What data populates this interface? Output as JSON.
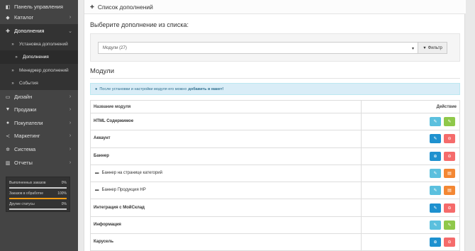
{
  "sidebar": {
    "items": [
      {
        "label": "Панель управления",
        "icon": "dashboard-icon",
        "glyph": "◧",
        "chevron": ""
      },
      {
        "label": "Каталог",
        "icon": "tag-icon",
        "glyph": "◆",
        "chevron": "›"
      },
      {
        "label": "Дополнения",
        "icon": "puzzle-icon",
        "glyph": "✚",
        "chevron": "⌄"
      },
      {
        "label": "Установка дополнений",
        "icon": "chevron-right-icon",
        "glyph": "»",
        "chevron": ""
      },
      {
        "label": "Дополнения",
        "icon": "chevron-right-icon",
        "glyph": "»",
        "chevron": ""
      },
      {
        "label": "Менеджер дополнений",
        "icon": "chevron-right-icon",
        "glyph": "»",
        "chevron": ""
      },
      {
        "label": "События",
        "icon": "chevron-right-icon",
        "glyph": "»",
        "chevron": ""
      },
      {
        "label": "Дизайн",
        "icon": "monitor-icon",
        "glyph": "▭",
        "chevron": "›"
      },
      {
        "label": "Продажи",
        "icon": "cart-icon",
        "glyph": "▼",
        "chevron": "›"
      },
      {
        "label": "Покупатели",
        "icon": "user-icon",
        "glyph": "●",
        "chevron": "›"
      },
      {
        "label": "Маркетинг",
        "icon": "share-icon",
        "glyph": "≺",
        "chevron": "›"
      },
      {
        "label": "Система",
        "icon": "gear-icon",
        "glyph": "✲",
        "chevron": "›"
      },
      {
        "label": "Отчеты",
        "icon": "bar-chart-icon",
        "glyph": "▥",
        "chevron": "›"
      }
    ],
    "stats": [
      {
        "label": "Выполненных заказов",
        "value": "0%",
        "fraction": 0,
        "color": "#f39c12"
      },
      {
        "label": "Заказов в обработке",
        "value": "100%",
        "fraction": 1,
        "color": "#f39c12"
      },
      {
        "label": "Другие статусы",
        "value": "0%",
        "fraction": 0,
        "color": "#f39c12"
      }
    ]
  },
  "main": {
    "panel_title": "Список дополнений",
    "choose_label": "Выберите дополнение из списка:",
    "select_value": "Модули (27)",
    "filter_label": "Фильтр",
    "section_heading": "Модули",
    "alert": {
      "text": "После установки и настройки модуля его можно",
      "link": "добавить в макет!"
    },
    "table": {
      "headers": {
        "name": "Название модуля",
        "action": "Действие"
      },
      "rows": [
        {
          "name": "HTML Содержимое",
          "bold": true,
          "folder": false,
          "b1": {
            "color": "c-lightblue",
            "icon": "pencil-icon",
            "glyph": "✎"
          },
          "b2": {
            "color": "c-green",
            "icon": "pencil-icon",
            "glyph": "✎"
          }
        },
        {
          "name": "Аккаунт",
          "bold": true,
          "folder": false,
          "b1": {
            "color": "c-blue",
            "icon": "pencil-icon",
            "glyph": "✎"
          },
          "b2": {
            "color": "c-red",
            "icon": "minus-circle-icon",
            "glyph": "⊖"
          }
        },
        {
          "name": "Баннер",
          "bold": true,
          "folder": false,
          "b1": {
            "color": "c-blue",
            "icon": "plus-circle-icon",
            "glyph": "⊕"
          },
          "b2": {
            "color": "c-red",
            "icon": "minus-circle-icon",
            "glyph": "⊖"
          }
        },
        {
          "name": "Баннер на странице категорий",
          "bold": false,
          "folder": true,
          "b1": {
            "color": "c-lightblue",
            "icon": "pencil-icon",
            "glyph": "✎"
          },
          "b2": {
            "color": "c-orange",
            "icon": "trash-icon",
            "glyph": "▤"
          }
        },
        {
          "name": "Баннер Продукция НР",
          "bold": false,
          "folder": true,
          "b1": {
            "color": "c-lightblue",
            "icon": "pencil-icon",
            "glyph": "✎"
          },
          "b2": {
            "color": "c-orange",
            "icon": "trash-icon",
            "glyph": "▤"
          }
        },
        {
          "name": "Интеграция с МойСклад",
          "bold": true,
          "folder": false,
          "b1": {
            "color": "c-blue",
            "icon": "pencil-icon",
            "glyph": "✎"
          },
          "b2": {
            "color": "c-red",
            "icon": "minus-circle-icon",
            "glyph": "⊖"
          }
        },
        {
          "name": "Информация",
          "bold": true,
          "folder": false,
          "b1": {
            "color": "c-lightblue",
            "icon": "pencil-icon",
            "glyph": "✎"
          },
          "b2": {
            "color": "c-green",
            "icon": "pencil-icon",
            "glyph": "✎"
          }
        },
        {
          "name": "Карусель",
          "bold": true,
          "folder": false,
          "b1": {
            "color": "c-blue",
            "icon": "plus-circle-icon",
            "glyph": "⊕"
          },
          "b2": {
            "color": "c-red",
            "icon": "minus-circle-icon",
            "glyph": "⊖"
          }
        }
      ]
    }
  }
}
